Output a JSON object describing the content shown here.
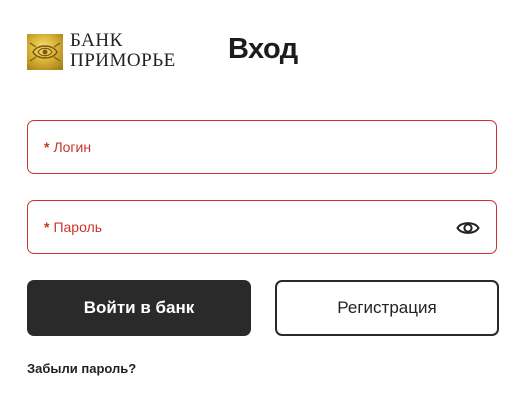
{
  "brand": {
    "line1": "БАНК",
    "line2": "ПРИМОРЬЕ"
  },
  "page_title": "Вход",
  "login_field": {
    "required_mark": "*",
    "label": "Логин",
    "value": ""
  },
  "password_field": {
    "required_mark": "*",
    "label": "Пароль",
    "value": "",
    "toggle_icon": "eye-icon"
  },
  "buttons": {
    "login": "Войти в банк",
    "register": "Регистрация"
  },
  "forgot_link": "Забыли пароль?",
  "colors": {
    "accent": "#c9352b",
    "primary_button": "#2a2a2a",
    "logo_gold": "#d9b336"
  }
}
